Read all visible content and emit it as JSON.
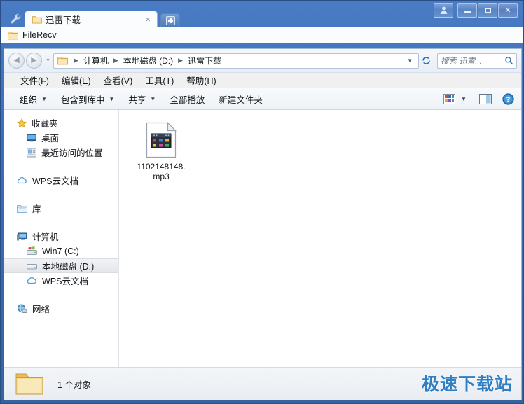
{
  "window": {
    "tab_title": "迅雷下载",
    "subtab_title": "FileRecv",
    "wrench_icon": "wrench-icon",
    "new_tab_label": "+",
    "close_tab_label": "×",
    "controls": {
      "user": "user-icon",
      "minimize": "minimize",
      "maximize": "maximize",
      "close": "✕"
    }
  },
  "address": {
    "back_label": "◀",
    "forward_label": "▶",
    "history_caret": "▼",
    "crumbs": [
      "计算机",
      "本地磁盘 (D:)",
      "迅雷下载"
    ],
    "separator": "▶",
    "dropdown_caret": "▼",
    "refresh_icon": "refresh-icon"
  },
  "search": {
    "placeholder": "搜索 迅雷...",
    "icon": "search-icon"
  },
  "menu": {
    "items": [
      {
        "label": "文件(F)"
      },
      {
        "label": "编辑(E)"
      },
      {
        "label": "查看(V)"
      },
      {
        "label": "工具(T)"
      },
      {
        "label": "帮助(H)"
      }
    ]
  },
  "toolbar": {
    "items": [
      {
        "label": "组织",
        "caret": "▼"
      },
      {
        "label": "包含到库中",
        "caret": "▼"
      },
      {
        "label": "共享",
        "caret": "▼"
      },
      {
        "label": "全部播放",
        "caret": ""
      },
      {
        "label": "新建文件夹",
        "caret": ""
      }
    ],
    "view_icon": "view-layout-icon",
    "view_caret": "▼",
    "preview_pane_icon": "preview-pane-icon",
    "help_icon": "help-icon",
    "help_glyph": "?"
  },
  "sidebar": {
    "groups": [
      {
        "items": [
          {
            "label": "收藏夹",
            "icon": "star-icon",
            "level": "root",
            "selected": false
          },
          {
            "label": "桌面",
            "icon": "desktop-icon",
            "level": "child",
            "selected": false
          },
          {
            "label": "最近访问的位置",
            "icon": "recent-places-icon",
            "level": "child",
            "selected": false
          }
        ]
      },
      {
        "items": [
          {
            "label": "WPS云文档",
            "icon": "cloud-icon",
            "level": "root",
            "selected": false
          }
        ]
      },
      {
        "items": [
          {
            "label": "库",
            "icon": "library-icon",
            "level": "root",
            "selected": false
          }
        ]
      },
      {
        "items": [
          {
            "label": "计算机",
            "icon": "computer-icon",
            "level": "root",
            "selected": false
          },
          {
            "label": "Win7 (C:)",
            "icon": "windows-drive-icon",
            "level": "child",
            "selected": false
          },
          {
            "label": "本地磁盘 (D:)",
            "icon": "drive-icon",
            "level": "child",
            "selected": true
          },
          {
            "label": "WPS云文档",
            "icon": "cloud-icon",
            "level": "child",
            "selected": false
          }
        ]
      },
      {
        "items": [
          {
            "label": "网络",
            "icon": "network-icon",
            "level": "root",
            "selected": false
          }
        ]
      }
    ]
  },
  "files": [
    {
      "name": "1102148148.mp3",
      "icon": "generic-file-icon"
    }
  ],
  "status": {
    "folder_icon": "folder-icon",
    "text": "1 个对象"
  },
  "watermark": {
    "text": "极速下载站",
    "color": "#2f7fc4"
  }
}
